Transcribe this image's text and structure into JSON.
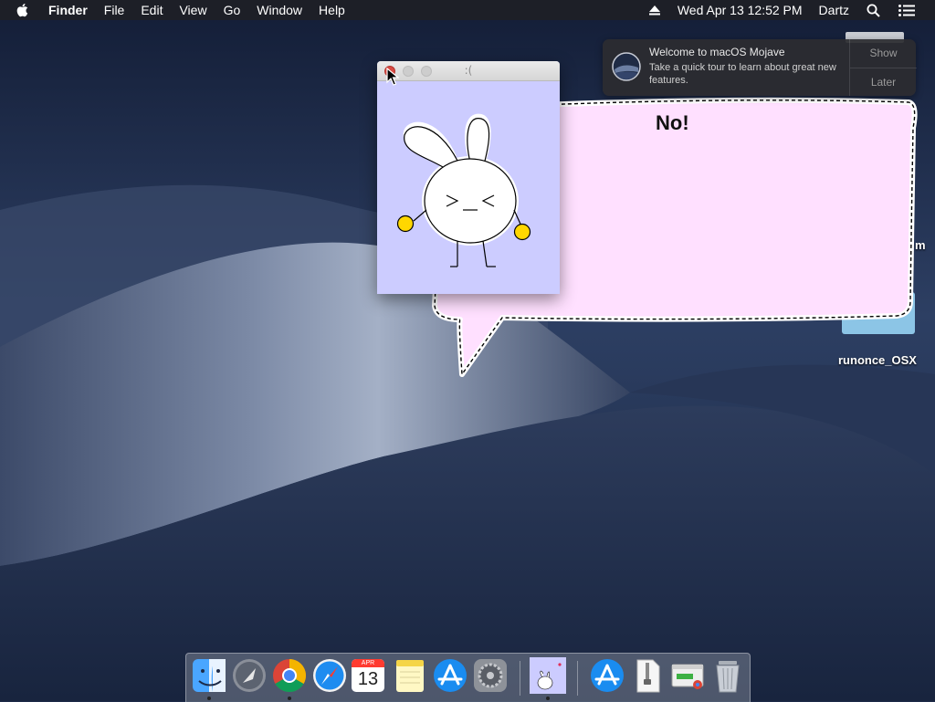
{
  "menubar": {
    "app_name": "Finder",
    "menus": [
      "File",
      "Edit",
      "View",
      "Go",
      "Window",
      "Help"
    ],
    "clock": "Wed Apr 13  12:52 PM",
    "user": "Dartz",
    "icons": [
      "apple-icon",
      "eject-icon",
      "spotlight-search-icon",
      "notification-center-icon"
    ]
  },
  "notification": {
    "title": "Welcome to macOS Mojave",
    "body": "Take a quick tour to learn about great new features.",
    "show_label": "Show",
    "later_label": "Later"
  },
  "desktop": {
    "partial_label": "m",
    "folder_label": "runonce_OSX"
  },
  "window": {
    "title": ":(",
    "background": "#ccccff"
  },
  "bubble": {
    "text": "No!",
    "fill": "#ffe0ff"
  },
  "dock": {
    "calendar_month": "APR",
    "calendar_day": "13",
    "items": [
      "finder-icon",
      "launchpad-icon",
      "chrome-icon",
      "safari-icon",
      "calendar-icon",
      "notes-icon",
      "app-store-icon",
      "system-preferences-icon",
      "bunny-app-icon",
      "app-store-icon",
      "archive-utility-icon",
      "chrome-app-icon",
      "trash-icon"
    ]
  }
}
